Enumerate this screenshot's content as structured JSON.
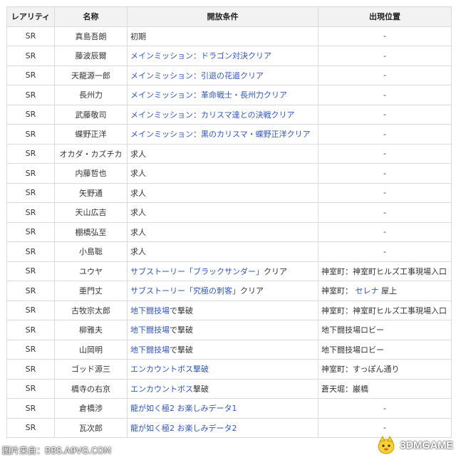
{
  "header": {
    "rarity": "レアリティ",
    "name": "名称",
    "condition": "開放条件",
    "location": "出現位置"
  },
  "rows": [
    {
      "rarity": "SR",
      "name": "真島吾朗",
      "cond_link": "",
      "cond_text": "初期",
      "loc_link": "",
      "loc_pre": "-",
      "loc_post": ""
    },
    {
      "rarity": "SR",
      "name": "藤波辰爾",
      "cond_link": "メインミッション：ドラゴン対決クリア",
      "cond_text": "",
      "loc_link": "",
      "loc_pre": "-",
      "loc_post": ""
    },
    {
      "rarity": "SR",
      "name": "天龍源一郎",
      "cond_link": "メインミッション：引退の花道クリア",
      "cond_text": "",
      "loc_link": "",
      "loc_pre": "-",
      "loc_post": ""
    },
    {
      "rarity": "SR",
      "name": "長州力",
      "cond_link": "メインミッション：革命戦士・長州力クリア",
      "cond_text": "",
      "loc_link": "",
      "loc_pre": "-",
      "loc_post": ""
    },
    {
      "rarity": "SR",
      "name": "武藤敬司",
      "cond_link": "メインミッション：カリスマ達との決戦クリア",
      "cond_text": "",
      "loc_link": "",
      "loc_pre": "-",
      "loc_post": ""
    },
    {
      "rarity": "SR",
      "name": "蝶野正洋",
      "cond_link": "メインミッション：黒のカリスマ・蝶野正洋クリア",
      "cond_text": "",
      "loc_link": "",
      "loc_pre": "-",
      "loc_post": ""
    },
    {
      "rarity": "SR",
      "name": "オカダ・カズチカ",
      "cond_link": "",
      "cond_text": "求人",
      "loc_link": "",
      "loc_pre": "-",
      "loc_post": ""
    },
    {
      "rarity": "SR",
      "name": "内藤哲也",
      "cond_link": "",
      "cond_text": "求人",
      "loc_link": "",
      "loc_pre": "-",
      "loc_post": ""
    },
    {
      "rarity": "SR",
      "name": "矢野通",
      "cond_link": "",
      "cond_text": "求人",
      "loc_link": "",
      "loc_pre": "-",
      "loc_post": ""
    },
    {
      "rarity": "SR",
      "name": "天山広吉",
      "cond_link": "",
      "cond_text": "求人",
      "loc_link": "",
      "loc_pre": "-",
      "loc_post": ""
    },
    {
      "rarity": "SR",
      "name": "棚橋弘至",
      "cond_link": "",
      "cond_text": "求人",
      "loc_link": "",
      "loc_pre": "-",
      "loc_post": ""
    },
    {
      "rarity": "SR",
      "name": "小島聡",
      "cond_link": "",
      "cond_text": "求人",
      "loc_link": "",
      "loc_pre": "-",
      "loc_post": ""
    },
    {
      "rarity": "SR",
      "name": "ユウヤ",
      "cond_link": "サブストーリー「ブラックサンダー」",
      "cond_text": "クリア",
      "loc_link": "",
      "loc_pre": "神室町：神室町ヒルズ工事現場入口",
      "loc_post": ""
    },
    {
      "rarity": "SR",
      "name": "亜門丈",
      "cond_link": "サブストーリー「究極の刺客」",
      "cond_text": "クリア",
      "loc_link": "セレナ",
      "loc_pre": "神室町：",
      "loc_post": "屋上"
    },
    {
      "rarity": "SR",
      "name": "古牧宗太郎",
      "cond_link": "地下闘技場",
      "cond_text": "で撃破",
      "loc_link": "",
      "loc_pre": "神室町：神室町ヒルズ工事現場入口",
      "loc_post": ""
    },
    {
      "rarity": "SR",
      "name": "柳雅夫",
      "cond_link": "地下闘技場",
      "cond_text": "で撃破",
      "loc_link": "",
      "loc_pre": "地下闘技場ロビー",
      "loc_post": ""
    },
    {
      "rarity": "SR",
      "name": "山岡明",
      "cond_link": "地下闘技場",
      "cond_text": "で撃破",
      "loc_link": "",
      "loc_pre": "地下闘技場ロビー",
      "loc_post": ""
    },
    {
      "rarity": "SR",
      "name": "ゴッド源三",
      "cond_link": "エンカウントボス撃破",
      "cond_text": "",
      "loc_link": "",
      "loc_pre": "神室町：すっぽん通り",
      "loc_post": ""
    },
    {
      "rarity": "SR",
      "name": "橋寺の右京",
      "cond_link": "エンカウントボス",
      "cond_text": "撃破",
      "loc_link": "",
      "loc_pre": "蒼天堀：巌橋",
      "loc_post": ""
    },
    {
      "rarity": "SR",
      "name": "倉橋渉",
      "cond_link": "龍が如く極2 お楽しみデータ1",
      "cond_text": "",
      "loc_link": "",
      "loc_pre": "-",
      "loc_post": ""
    },
    {
      "rarity": "SR",
      "name": "瓦次郎",
      "cond_link": "龍が如く極2 お楽しみデータ2",
      "cond_text": "",
      "loc_link": "",
      "loc_pre": "-",
      "loc_post": ""
    }
  ],
  "watermark": {
    "left": "图片来自：BBS.A9VG.COM",
    "right": "3DMGAME"
  },
  "colors": {
    "link": "#2f55c6",
    "header_bg": "#f2f2f2",
    "border": "#dadada"
  }
}
